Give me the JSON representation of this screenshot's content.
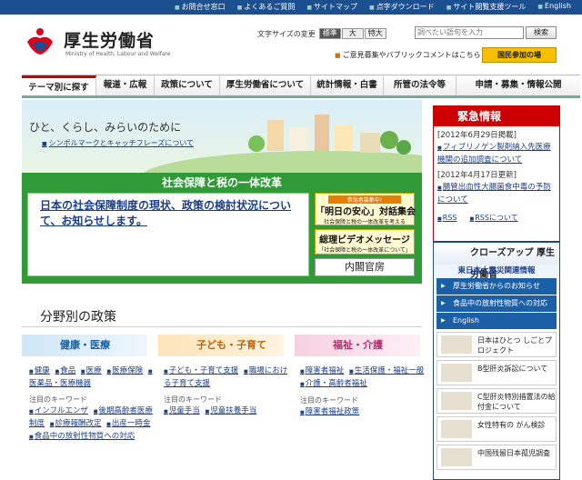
{
  "util_links": [
    "お問合せ窓口",
    "よくあるご質問",
    "サイトマップ",
    "点字ダウンロード",
    "サイト閲覧支援ツール",
    "English"
  ],
  "logo": {
    "ja": "厚生労働省",
    "en": "Ministry of Health, Labour and Welfare"
  },
  "font_size": {
    "label": "文字サイズの変更",
    "options": [
      "標準",
      "大",
      "特大"
    ]
  },
  "search": {
    "placeholder": "調べたい語句を入力",
    "button": "検索"
  },
  "opinion_link": "ご意見募集やパブリックコメントはこちら",
  "kokumin_button": "国民参加の場",
  "nav": [
    "テーマ別に探す",
    "報道・広報",
    "政策について",
    "厚生労働省について",
    "統計情報・白書",
    "所管の法令等",
    "申請・募集・情報公開"
  ],
  "hero": {
    "tagline": "ひと、くらし、みらいのために",
    "link": "シンボルマークとキャッチフレーズについて"
  },
  "reform": {
    "title": "社会保障と税の一体改革",
    "main_text": "日本の社会保障制度の現状、政策の検討状況について、お知らせします。",
    "box1": {
      "tag": "参加者募集中!",
      "main": "「明日の安心」対話集会",
      "sub": "社会保障と税の一体改革を考える"
    },
    "box2": {
      "main": "総理ビデオメッセージ",
      "sub": "「社会保障と税の一体改革について」"
    },
    "naikaku": "内閣官房"
  },
  "policies": {
    "title": "分野別の政策",
    "keyword_label": "注目のキーワード",
    "columns": [
      {
        "category": "健康・医療",
        "links": [
          "健康",
          "食品",
          "医療",
          "医療保険",
          "医薬品・医療機器"
        ],
        "keywords": [
          "インフルエンザ",
          "後期高齢者医療制度",
          "診療報酬改定",
          "出産一時金",
          "食品中の放射性物質への対応"
        ]
      },
      {
        "category": "子ども・子育て",
        "links": [
          "子ども・子育て支援",
          "職場における子育て支援"
        ],
        "keywords": [
          "児童手当",
          "児童扶養手当"
        ]
      },
      {
        "category": "福祉・介護",
        "links": [
          "障害者福祉",
          "生活保護・福祉一般",
          "介護・高齢者福祉"
        ],
        "keywords": [
          "障害者福祉政策"
        ]
      }
    ]
  },
  "emergency": {
    "title": "緊急情報",
    "items": [
      {
        "date": "[2012年6月29日掲載]",
        "text": "フィブリノゲン製剤納入先医療機関の追加調査について"
      },
      {
        "date": "[2012年4月17日更新]",
        "text": "腸管出血性大腸菌食中毒の予防について"
      }
    ],
    "rss": [
      "RSS",
      "RSSについて"
    ]
  },
  "closeup": {
    "title": "クローズアップ 厚生労働省",
    "subtitle": "東日本大震災関連情報",
    "blue_links": [
      "厚生労働省からのお知らせ",
      "食品中の放射性物質への対応",
      "English"
    ],
    "items": [
      "日本はひとつ しごとプロジェクト",
      "B型肝炎訴訟について",
      "C型肝炎特別措置法の給付金について",
      "女性特有の がん検診",
      "中国残留日本孤児調査"
    ]
  }
}
